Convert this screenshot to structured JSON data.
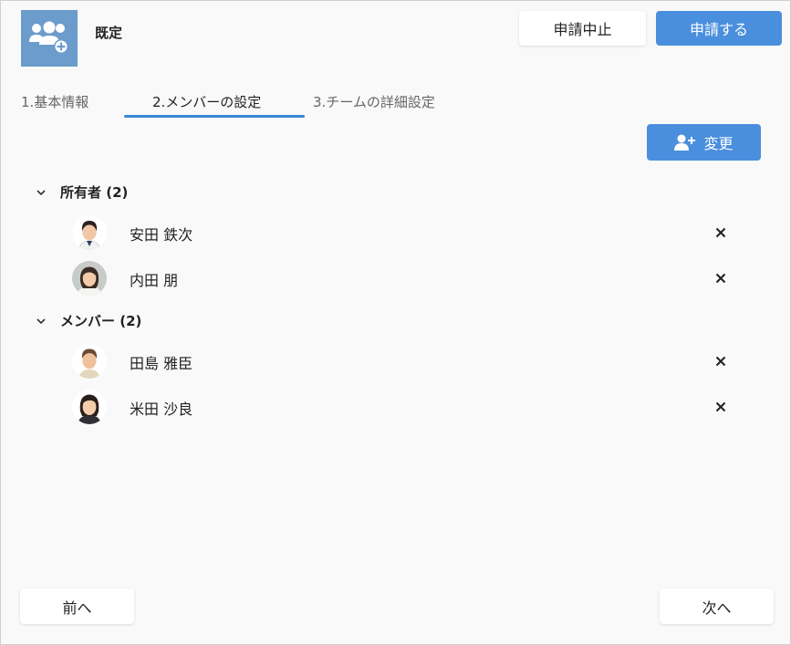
{
  "header": {
    "title": "既定",
    "cancel_label": "申請中止",
    "submit_label": "申請する"
  },
  "tabs": [
    {
      "label": "1.基本情報"
    },
    {
      "label": "2.メンバーの設定",
      "active": true
    },
    {
      "label": "3.チームの詳細設定"
    }
  ],
  "toolbar": {
    "change_label": "変更"
  },
  "groups": [
    {
      "label": "所有者 (2)",
      "members": [
        {
          "name": "安田 鉄次"
        },
        {
          "name": "内田 朋"
        }
      ]
    },
    {
      "label": "メンバー (2)",
      "members": [
        {
          "name": "田島 雅臣"
        },
        {
          "name": "米田 沙良"
        }
      ]
    }
  ],
  "footer": {
    "prev_label": "前へ",
    "next_label": "次へ"
  },
  "colors": {
    "accent": "#4a8fdd",
    "app_icon_bg": "#6c9ccc",
    "tab_underline": "#3b87d6",
    "background": "#f9f9f9"
  },
  "icons": {
    "app": "users-add-icon",
    "change": "user-add-icon",
    "group_toggle": "chevron-down-icon",
    "remove": "close-icon"
  }
}
